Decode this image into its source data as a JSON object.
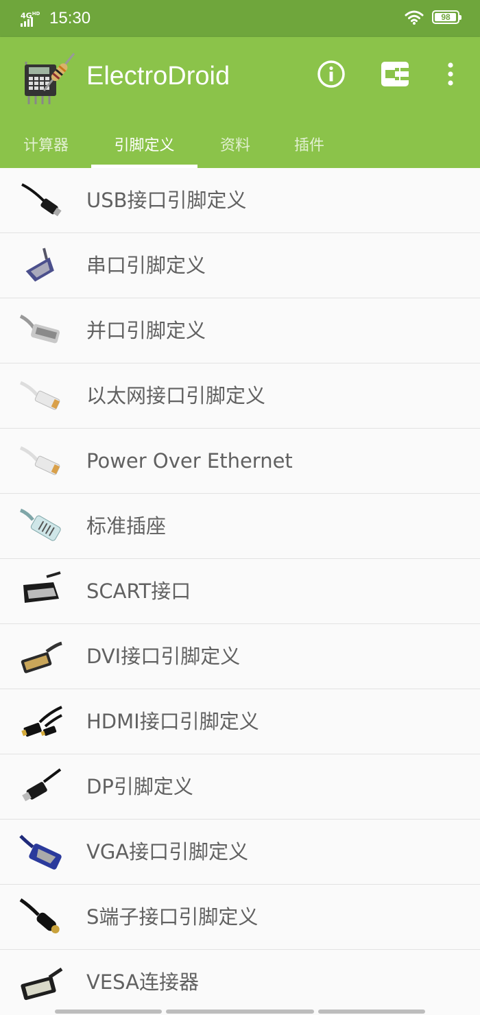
{
  "status_bar": {
    "network": "4G",
    "network_sup": "HD",
    "time": "15:30",
    "battery": 98
  },
  "app": {
    "title": "ElectroDroid"
  },
  "actions": {
    "info_icon": "info-icon",
    "plugin_icon": "plugin-icon",
    "menu_icon": "more-vert-icon"
  },
  "tabs": [
    {
      "label": "计算器",
      "active": false
    },
    {
      "label": "引脚定义",
      "active": true
    },
    {
      "label": "资料",
      "active": false
    },
    {
      "label": "插件",
      "active": false
    }
  ],
  "items": [
    {
      "label": "USB接口引脚定义",
      "icon": "usb-cable-icon"
    },
    {
      "label": "串口引脚定义",
      "icon": "serial-port-icon"
    },
    {
      "label": "并口引脚定义",
      "icon": "parallel-port-icon"
    },
    {
      "label": "以太网接口引脚定义",
      "icon": "ethernet-icon"
    },
    {
      "label": "Power Over Ethernet",
      "icon": "poe-ethernet-icon"
    },
    {
      "label": "标准插座",
      "icon": "phone-jack-icon"
    },
    {
      "label": "SCART接口",
      "icon": "scart-icon"
    },
    {
      "label": "DVI接口引脚定义",
      "icon": "dvi-icon"
    },
    {
      "label": "HDMI接口引脚定义",
      "icon": "hdmi-icon"
    },
    {
      "label": "DP引脚定义",
      "icon": "displayport-icon"
    },
    {
      "label": "VGA接口引脚定义",
      "icon": "vga-icon"
    },
    {
      "label": "S端子接口引脚定义",
      "icon": "s-video-icon"
    },
    {
      "label": "VESA连接器",
      "icon": "vesa-icon"
    }
  ],
  "colors": {
    "status": "#6fa63c",
    "appbar": "#8bc34a",
    "text": "#616161"
  }
}
